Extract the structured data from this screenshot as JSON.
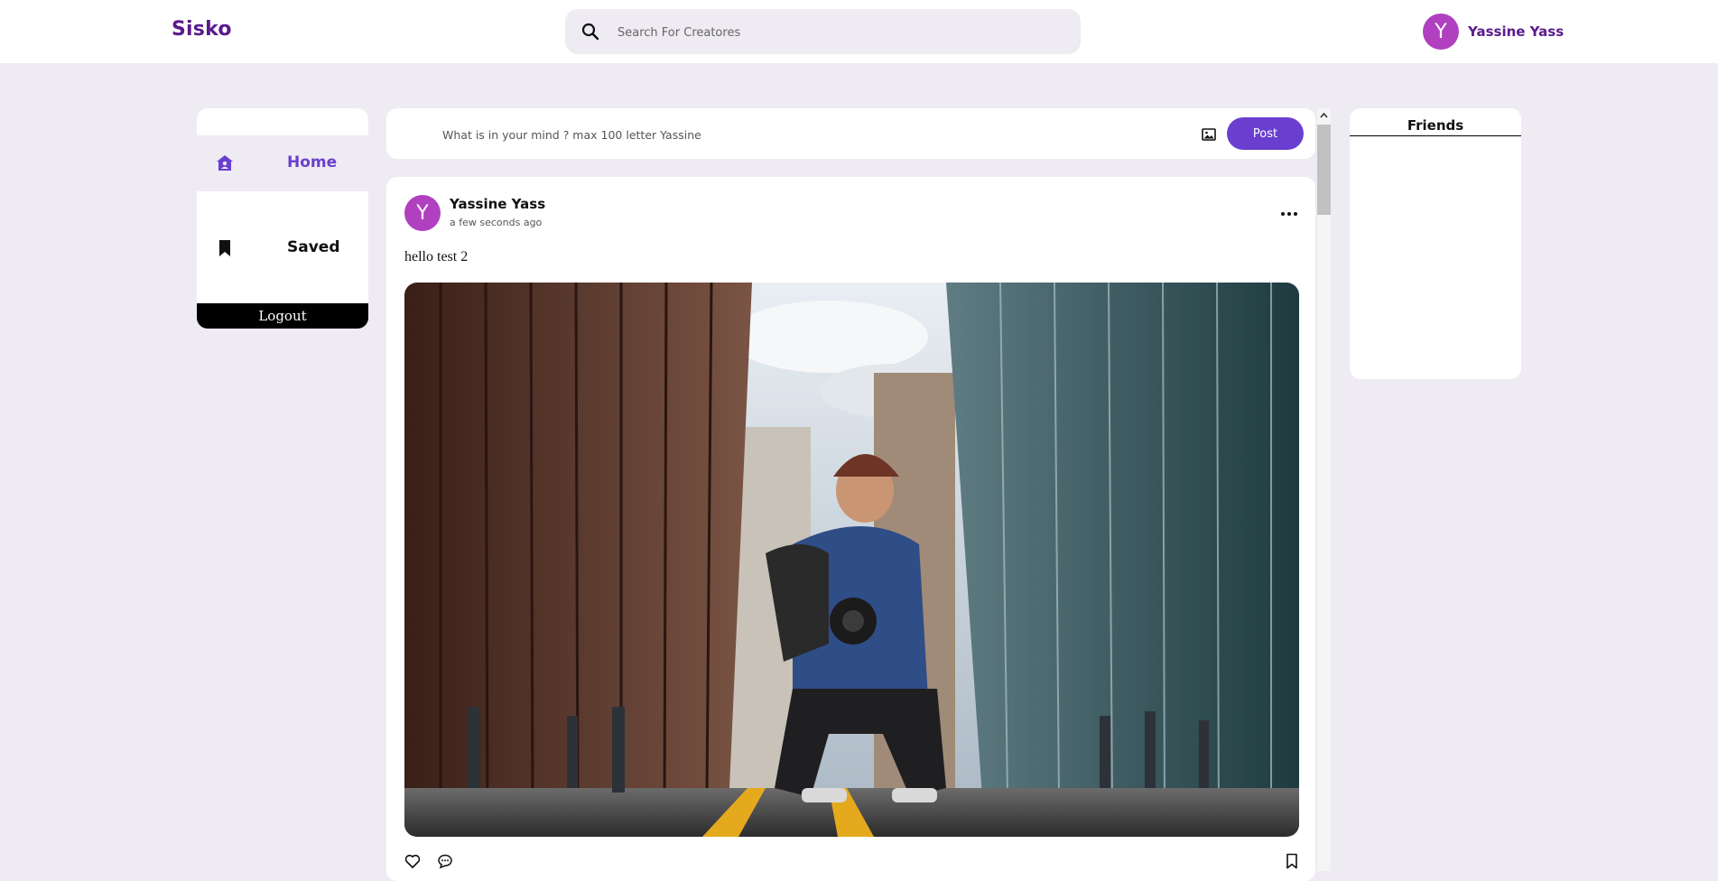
{
  "app": {
    "logo": "Sisko"
  },
  "search": {
    "placeholder": "Search For Creatores"
  },
  "user": {
    "initial": "Y",
    "name": "Yassine Yass"
  },
  "sidebar": {
    "items": [
      {
        "label": "Home",
        "icon": "home-icon",
        "active": true
      },
      {
        "label": "Saved",
        "icon": "bookmark-icon",
        "active": false
      }
    ],
    "logout_label": "Logout"
  },
  "composer": {
    "placeholder": "What is in your mind ? max 100 letter Yassine",
    "post_label": "Post",
    "image_icon": "image-icon"
  },
  "post": {
    "author_initial": "Y",
    "author": "Yassine Yass",
    "time": "a few seconds ago",
    "text": "hello test 2",
    "image_alt": "photographer crouching in street between skyscrapers"
  },
  "friends": {
    "title": "Friends"
  },
  "colors": {
    "brand": "#5a1b8c",
    "accent": "#6a3fd0",
    "avatar": "#b040c0",
    "background": "#eeebf2"
  }
}
